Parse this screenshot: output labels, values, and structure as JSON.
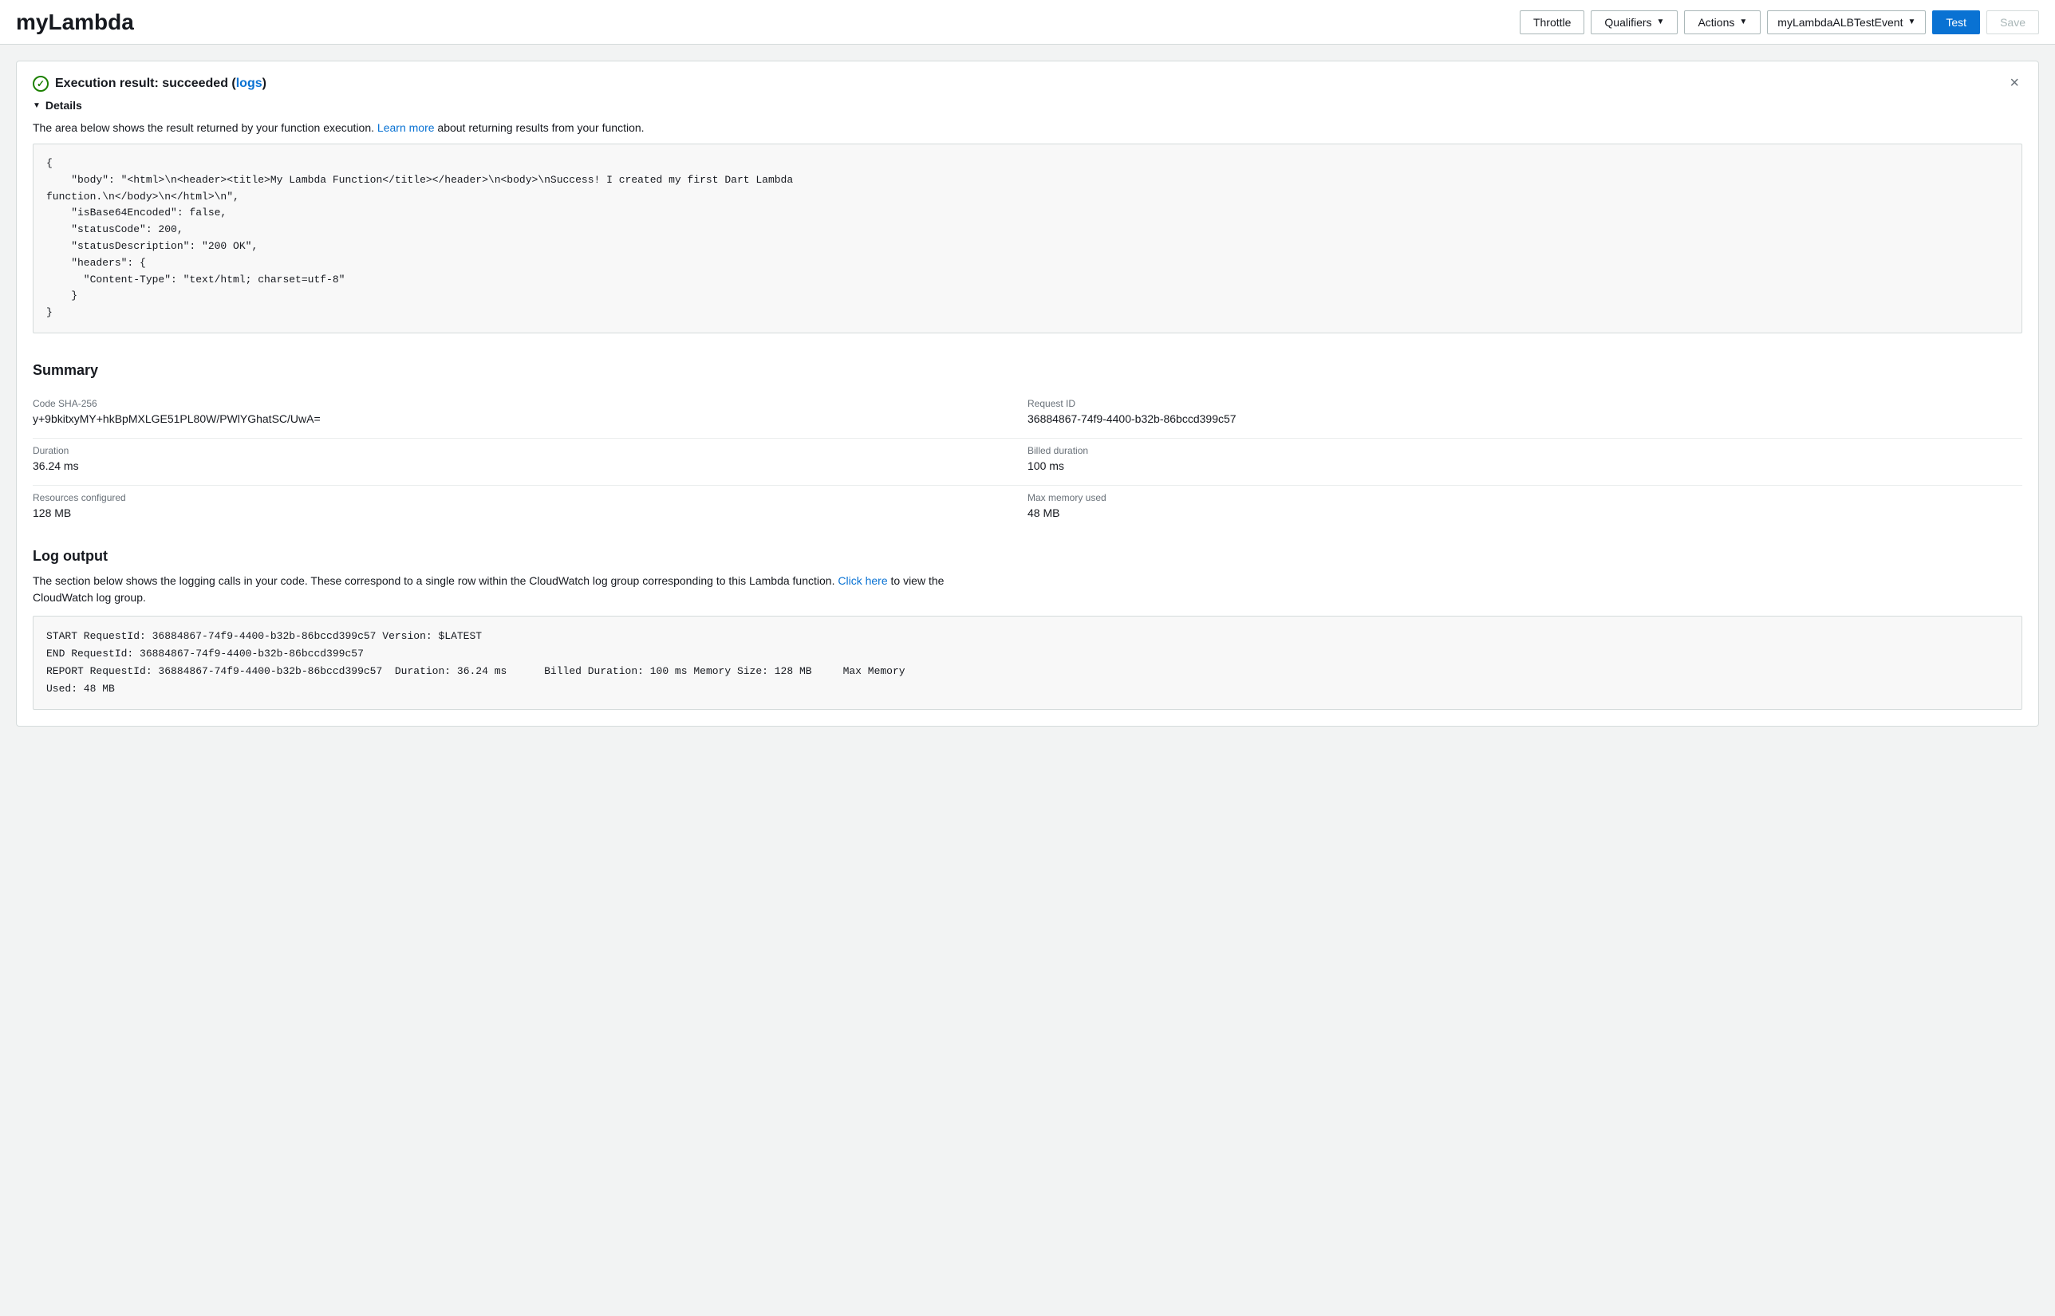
{
  "header": {
    "title": "myLambda",
    "throttle_label": "Throttle",
    "qualifiers_label": "Qualifiers",
    "actions_label": "Actions",
    "event_selector": "myLambdaALBTestEvent",
    "test_label": "Test",
    "save_label": "Save"
  },
  "result": {
    "status_text": "Execution result: succeeded (",
    "logs_text": "logs",
    "status_close_icon": "×",
    "details_label": "Details",
    "description_before": "The area below shows the result returned by your function execution.",
    "learn_more_text": "Learn more",
    "description_after": "about returning results from your function.",
    "code_content": "{\n    \"body\": \"<html>\\n<header><title>My Lambda Function</title></header>\\n<body>\\nSuccess! I created my first Dart Lambda\nfunction.\\n</body>\\n</html>\\n\",\n    \"isBase64Encoded\": false,\n    \"statusCode\": 200,\n    \"statusDescription\": \"200 OK\",\n    \"headers\": {\n      \"Content-Type\": \"text/html; charset=utf-8\"\n    }\n}"
  },
  "summary": {
    "title": "Summary",
    "items": [
      {
        "label": "Code SHA-256",
        "value": "y+9bkitxyMY+hkBpMXLGE51PL80W/PWlYGhatSC/UwA="
      },
      {
        "label": "Request ID",
        "value": "36884867-74f9-4400-b32b-86bccd399c57"
      },
      {
        "label": "Duration",
        "value": "36.24 ms"
      },
      {
        "label": "Billed duration",
        "value": "100 ms"
      },
      {
        "label": "Resources configured",
        "value": "128 MB"
      },
      {
        "label": "Max memory used",
        "value": "48 MB"
      }
    ]
  },
  "log_output": {
    "title": "Log output",
    "description_before": "The section below shows the logging calls in your code. These correspond to a single row within the CloudWatch log group corresponding to this Lambda function.",
    "click_here_text": "Click here",
    "description_after": "to view the\nCloudWatch log group.",
    "log_content": "START RequestId: 36884867-74f9-4400-b32b-86bccd399c57 Version: $LATEST\nEND RequestId: 36884867-74f9-4400-b32b-86bccd399c57\nREPORT RequestId: 36884867-74f9-4400-b32b-86bccd399c57\tDuration: 36.24 ms\tBilled Duration: 100 ms Memory Size: 128 MB\tMax Memory\nUsed: 48 MB"
  }
}
